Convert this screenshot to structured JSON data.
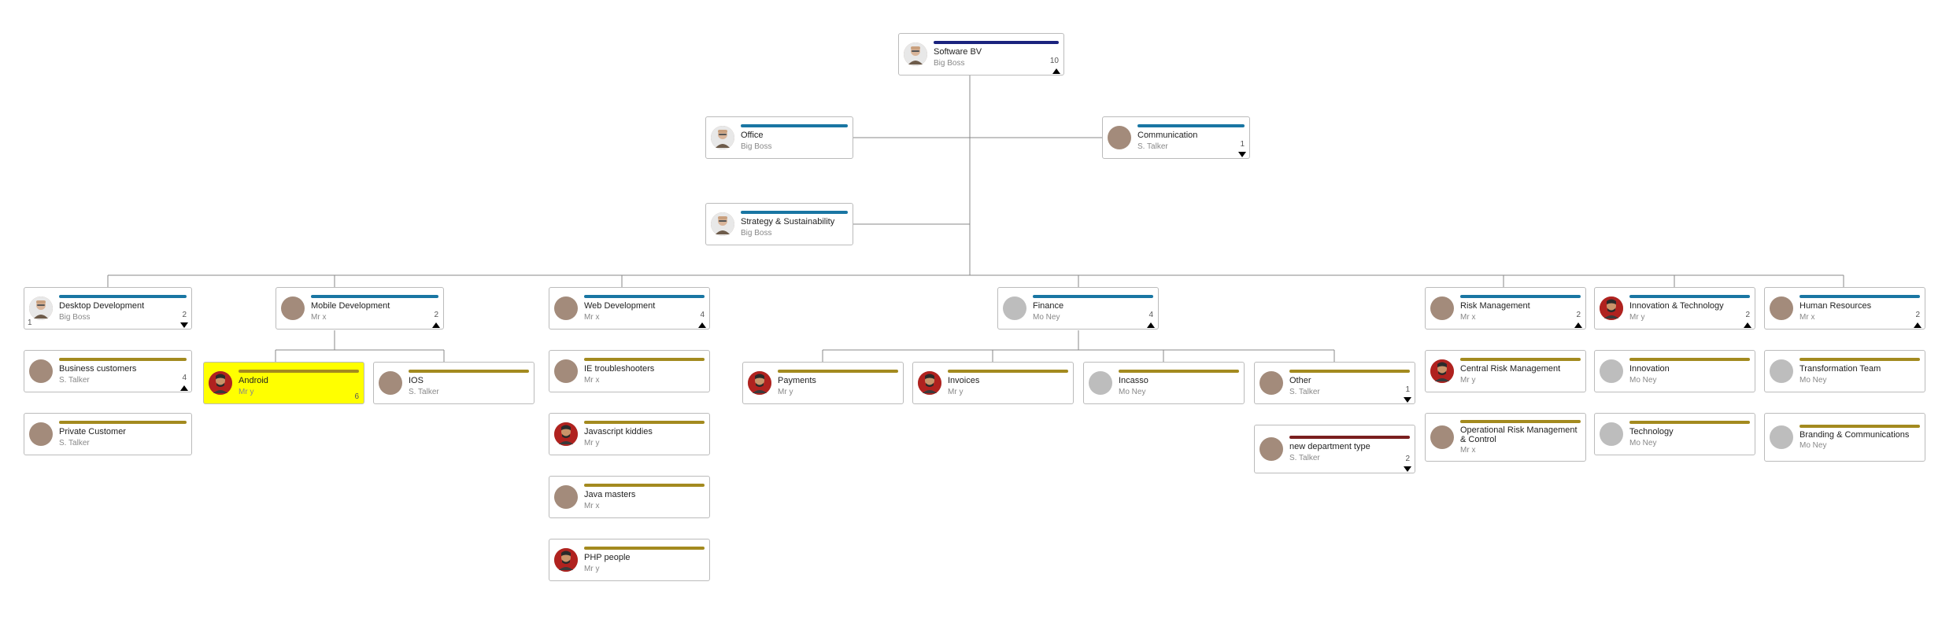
{
  "colors": {
    "navy": "#1a237e",
    "teal": "#1976a3",
    "olive": "#a38a1f",
    "darkred": "#7a1f1f",
    "gray": "#bdbdbd",
    "tan": "#a38b7b"
  },
  "nodes": {
    "root": {
      "title": "Software BV",
      "sub": "Big Boss",
      "bar": "navy",
      "avatar": "boss",
      "right_count": "10",
      "toggle": "up"
    },
    "office": {
      "title": "Office",
      "sub": "Big Boss",
      "bar": "teal",
      "avatar": "boss"
    },
    "comm": {
      "title": "Communication",
      "sub": "S. Talker",
      "bar": "teal",
      "avatar": "tan",
      "right_count": "1",
      "toggle": "down"
    },
    "strat": {
      "title": "Strategy & Sustainability",
      "sub": "Big Boss",
      "bar": "teal",
      "avatar": "boss"
    },
    "desktop": {
      "title": "Desktop Development",
      "sub": "Big Boss",
      "bar": "teal",
      "avatar": "boss",
      "left_count": "1",
      "right_count": "2",
      "toggle": "down"
    },
    "bizcust": {
      "title": "Business customers",
      "sub": "S. Talker",
      "bar": "olive",
      "avatar": "tan",
      "right_count": "4",
      "toggle": "up"
    },
    "privcust": {
      "title": "Private Customer",
      "sub": "S. Talker",
      "bar": "olive",
      "avatar": "tan"
    },
    "mobile": {
      "title": "Mobile Development",
      "sub": "Mr x",
      "bar": "teal",
      "avatar": "tan",
      "right_count": "2",
      "toggle": "up"
    },
    "android": {
      "title": "Android",
      "sub": "Mr y",
      "bar": "olive",
      "avatar": "mry",
      "right_count": "6",
      "selected": true
    },
    "ios": {
      "title": "IOS",
      "sub": "S. Talker",
      "bar": "olive",
      "avatar": "tan"
    },
    "web": {
      "title": "Web Development",
      "sub": "Mr x",
      "bar": "teal",
      "avatar": "tan",
      "right_count": "4",
      "toggle": "up"
    },
    "ie": {
      "title": "IE troubleshooters",
      "sub": "Mr x",
      "bar": "olive",
      "avatar": "tan"
    },
    "js": {
      "title": "Javascript kiddies",
      "sub": "Mr y",
      "bar": "olive",
      "avatar": "mry"
    },
    "java": {
      "title": "Java masters",
      "sub": "Mr x",
      "bar": "olive",
      "avatar": "tan"
    },
    "php": {
      "title": "PHP people",
      "sub": "Mr y",
      "bar": "olive",
      "avatar": "mry"
    },
    "finance": {
      "title": "Finance",
      "sub": "Mo Ney",
      "bar": "teal",
      "avatar": "gray",
      "right_count": "4",
      "toggle": "up"
    },
    "pay": {
      "title": "Payments",
      "sub": "Mr y",
      "bar": "olive",
      "avatar": "mry"
    },
    "inv": {
      "title": "Invoices",
      "sub": "Mr y",
      "bar": "olive",
      "avatar": "mry"
    },
    "inc": {
      "title": "Incasso",
      "sub": "Mo Ney",
      "bar": "olive",
      "avatar": "gray"
    },
    "other": {
      "title": "Other",
      "sub": "S. Talker",
      "bar": "olive",
      "avatar": "tan",
      "right_count": "1",
      "toggle": "down"
    },
    "newdept": {
      "title": "new department type",
      "sub": "S. Talker",
      "bar": "darkred",
      "avatar": "tan",
      "right_count": "2",
      "toggle": "down"
    },
    "risk": {
      "title": "Risk Management",
      "sub": "Mr x",
      "bar": "teal",
      "avatar": "tan",
      "right_count": "2",
      "toggle": "up"
    },
    "crisk": {
      "title": "Central Risk Management",
      "sub": "Mr y",
      "bar": "olive",
      "avatar": "mry"
    },
    "orisk": {
      "title": "Operational Risk Management & Control",
      "sub": "Mr x",
      "bar": "olive",
      "avatar": "tan",
      "wrap": true
    },
    "innov": {
      "title": "Innovation & Technology",
      "sub": "Mr y",
      "bar": "teal",
      "avatar": "mry",
      "right_count": "2",
      "toggle": "up"
    },
    "innov2": {
      "title": "Innovation",
      "sub": "Mo Ney",
      "bar": "olive",
      "avatar": "gray"
    },
    "tech": {
      "title": "Technology",
      "sub": "Mo Ney",
      "bar": "olive",
      "avatar": "gray"
    },
    "hr": {
      "title": "Human Resources",
      "sub": "Mr x",
      "bar": "teal",
      "avatar": "tan",
      "right_count": "2",
      "toggle": "up"
    },
    "trans": {
      "title": "Transformation Team",
      "sub": "Mo Ney",
      "bar": "olive",
      "avatar": "gray"
    },
    "brand": {
      "title": "Branding & Communications",
      "sub": "Mo Ney",
      "bar": "olive",
      "avatar": "gray",
      "wrap": true
    }
  }
}
